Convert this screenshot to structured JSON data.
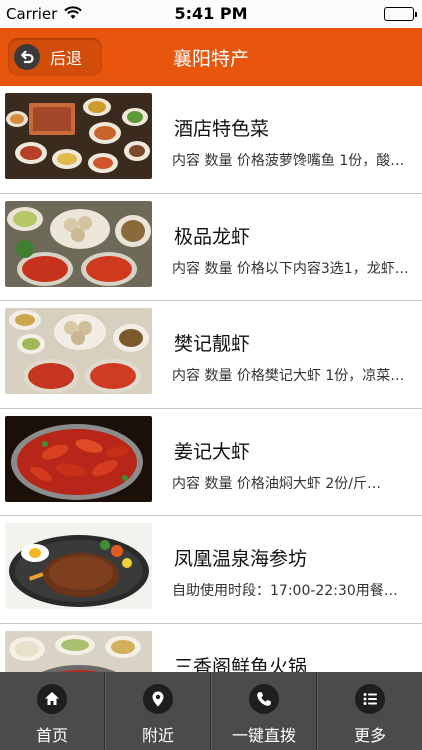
{
  "status_bar": {
    "carrier": "Carrier",
    "time": "5:41 PM"
  },
  "nav": {
    "back_label": "后退",
    "title": "襄阳特产",
    "color": "#e8560d"
  },
  "items": [
    {
      "title": "酒店特色菜",
      "desc": "内容 数量 价格菠萝馋嘴鱼 1份，酸菜鱼…"
    },
    {
      "title": "极品龙虾",
      "desc": "内容 数量 价格以下内容3选1，龙虾…"
    },
    {
      "title": "樊记靓虾",
      "desc": "内容 数量 价格樊记大虾 1份，凉菜…"
    },
    {
      "title": "姜记大虾",
      "desc": "内容 数量 价格油焖大虾 2份/斤…"
    },
    {
      "title": "凤凰温泉海参坊",
      "desc": "自助使用时段：17:00-22:30用餐…"
    },
    {
      "title": "三香阁鲜鱼火锅",
      "desc": ""
    }
  ],
  "tabs": [
    {
      "label": "首页",
      "icon": "home-icon"
    },
    {
      "label": "附近",
      "icon": "location-pin-icon"
    },
    {
      "label": "一键直拨",
      "icon": "phone-icon"
    },
    {
      "label": "更多",
      "icon": "more-list-icon"
    }
  ]
}
